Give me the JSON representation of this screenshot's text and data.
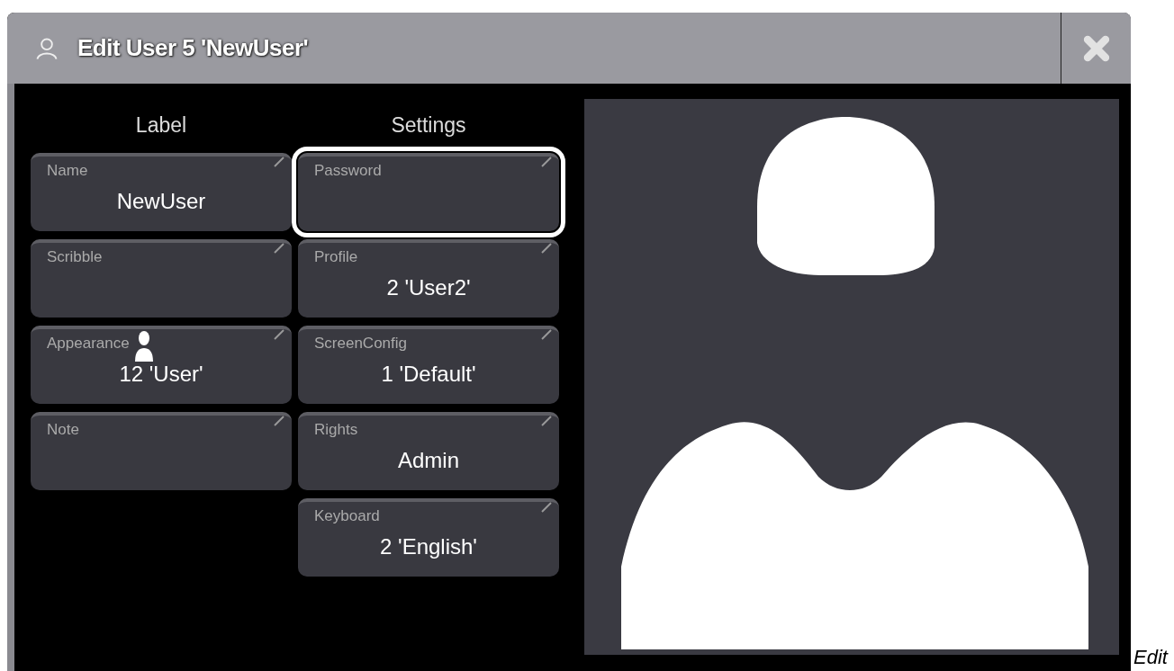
{
  "window": {
    "title": "Edit User 5 'NewUser'"
  },
  "columns": [
    {
      "heading": "Label",
      "fields": [
        {
          "label": "Name",
          "value": "NewUser",
          "kind": "plain",
          "selected": false
        },
        {
          "label": "Scribble",
          "kind": "plain",
          "selected": false
        },
        {
          "label": "Appearance",
          "value": "12 'User'",
          "kind": "swatch",
          "selected": false
        },
        {
          "label": "Note",
          "kind": "plain",
          "selected": false
        }
      ]
    },
    {
      "heading": "Settings",
      "fields": [
        {
          "label": "Password",
          "kind": "plain",
          "selected": true
        },
        {
          "label": "Profile",
          "value": "2 'User2'",
          "kind": "plain",
          "selected": false
        },
        {
          "label": "ScreenConfig",
          "value": "1 'Default'",
          "kind": "plain",
          "selected": false
        },
        {
          "label": "Rights",
          "value": "Admin",
          "kind": "plain",
          "selected": false
        },
        {
          "label": "Keyboard",
          "value": "2 'English'",
          "kind": "plain",
          "selected": false
        }
      ]
    }
  ],
  "caption": "Edit"
}
